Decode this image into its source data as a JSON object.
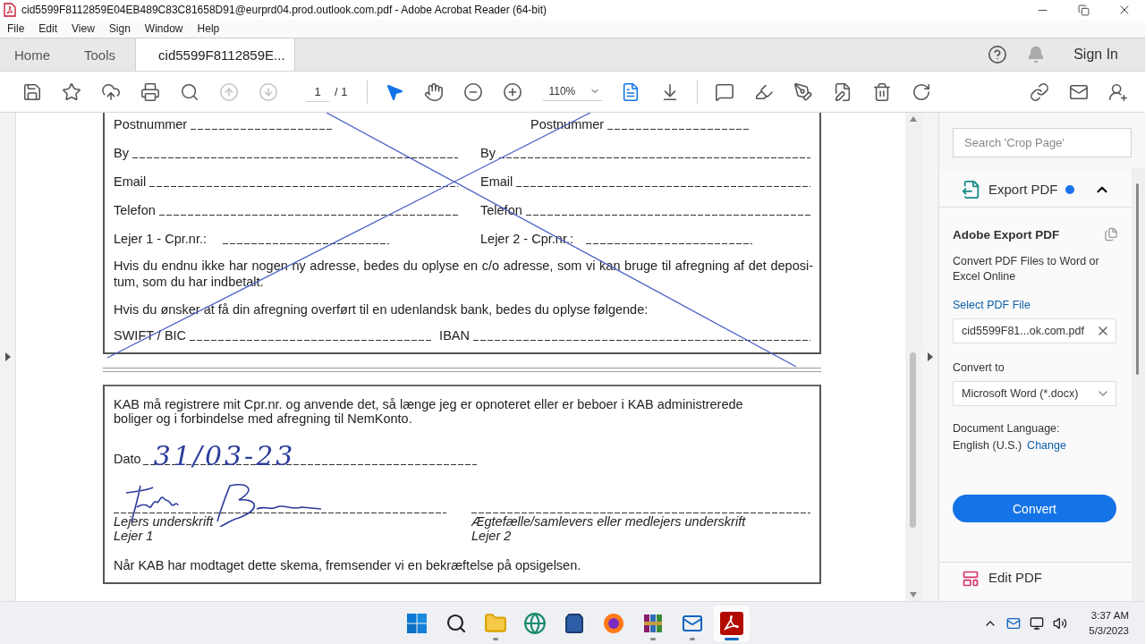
{
  "window": {
    "title": "cid5599F8112859E04EB489C83C81658D91@eurprd04.prod.outlook.com.pdf - Adobe Acrobat Reader (64-bit)"
  },
  "menu": [
    "File",
    "Edit",
    "View",
    "Sign",
    "Window",
    "Help"
  ],
  "tabs": [
    {
      "label": "Home",
      "selected": false
    },
    {
      "label": "Tools",
      "selected": false
    },
    {
      "label": "cid5599F8112859E...",
      "selected": true
    }
  ],
  "header": {
    "sign_in": "Sign In",
    "notifications_disabled": true
  },
  "toolbar": {
    "page": "1",
    "page_total": "/ 1",
    "zoom": "110%",
    "tools": [
      {
        "kind": "save",
        "selected": false,
        "disabled": false
      },
      {
        "kind": "bookmark",
        "selected": false,
        "disabled": false
      },
      {
        "kind": "upload",
        "selected": false,
        "disabled": false
      },
      {
        "kind": "print",
        "selected": false,
        "disabled": false
      },
      {
        "kind": "find",
        "selected": false,
        "disabled": false
      },
      {
        "kind": "prev",
        "selected": false,
        "disabled": true
      },
      {
        "kind": "next",
        "selected": false,
        "disabled": true
      },
      {
        "kind": "page"
      },
      {
        "kind": "separator"
      },
      {
        "kind": "select",
        "selected": true,
        "disabled": false
      },
      {
        "kind": "hand",
        "selected": false,
        "disabled": false
      },
      {
        "kind": "zoom_out",
        "selected": false,
        "disabled": false
      },
      {
        "kind": "zoom_in",
        "selected": false,
        "disabled": false
      },
      {
        "kind": "zoom"
      },
      {
        "kind": "fit",
        "selected": true,
        "disabled": false
      },
      {
        "kind": "scroll",
        "selected": false,
        "disabled": false
      },
      {
        "kind": "separator"
      },
      {
        "kind": "comment",
        "selected": false,
        "disabled": false
      },
      {
        "kind": "highlight",
        "selected": false,
        "disabled": false
      },
      {
        "kind": "sign",
        "selected": false,
        "disabled": false
      },
      {
        "kind": "organize",
        "selected": false,
        "disabled": false
      },
      {
        "kind": "delete",
        "selected": false,
        "disabled": false
      },
      {
        "kind": "rotate",
        "selected": false,
        "disabled": false
      },
      {
        "kind": "spacer"
      },
      {
        "kind": "share_link",
        "selected": false,
        "disabled": false
      },
      {
        "kind": "email",
        "selected": false,
        "disabled": false
      },
      {
        "kind": "add_user",
        "selected": false,
        "disabled": false
      }
    ]
  },
  "document": {
    "crossed_out": true,
    "address_rows": [
      {
        "kind": "postal",
        "left": "Postnummer",
        "right": "Postnummer"
      },
      {
        "kind": "full",
        "left": "By",
        "right": "By"
      },
      {
        "kind": "full",
        "left": "Email",
        "right": "Email"
      },
      {
        "kind": "full",
        "left": "Telefon",
        "right": "Telefon"
      },
      {
        "kind": "cpr",
        "left": "Lejer 1 - Cpr.nr.:",
        "right": "Lejer 2 - Cpr.nr.:"
      }
    ],
    "notes": [
      "Hvis du endnu ikke har nogen ny adresse, bedes du oplyse en c/o adresse, som vi kan bruge til afregning af det deposi-tum, som du har indbetalt.",
      "Hvis du ønsker at få din afregning overført til en udenlandsk bank, bedes du oplyse følgende:"
    ],
    "bank": [
      "SWIFT / BIC",
      "IBAN"
    ],
    "consent": "KAB må registrere mit Cpr.nr. og anvende det, så længe jeg er opnoteret eller er beboer i KAB administrerede boliger og i forbindelse med afregning til NemKonto.",
    "date": {
      "label": "Dato",
      "value": "31/03-23"
    },
    "signatures": [
      {
        "caption": "Lejers underskrift",
        "tenant": "Lejer 1",
        "signed": true
      },
      {
        "caption": "Ægtefælle/samlevers eller medlejers underskrift",
        "tenant": "Lejer 2",
        "signed": false
      }
    ],
    "footer": "Når KAB har modtaget dette skema, fremsender vi en bekræftelse på opsigelsen."
  },
  "side_panel": {
    "search": {
      "placeholder": "Search 'Crop Page'"
    },
    "tool": {
      "title": "Export PDF",
      "expanded": true
    },
    "heading": "Adobe Export PDF",
    "description": "Convert PDF Files to Word or Excel Online",
    "select_link": "Select PDF File",
    "file": {
      "value": "cid5599F81...ok.com.pdf"
    },
    "convert_label": "Convert to",
    "format": {
      "value": "Microsoft Word (*.docx)"
    },
    "language_label": "Document Language:",
    "language": "English (U.S.)",
    "change_link": "Change",
    "convert_button": "Convert",
    "next_tool": "Edit PDF"
  },
  "taskbar": {
    "apps": [
      {
        "kind": "start",
        "running": false,
        "selected": false
      },
      {
        "kind": "search",
        "running": false,
        "selected": false
      },
      {
        "kind": "explorer",
        "running": true,
        "selected": false
      },
      {
        "kind": "edge",
        "running": false,
        "selected": false
      },
      {
        "kind": "store",
        "running": false,
        "selected": false
      },
      {
        "kind": "firefox",
        "running": false,
        "selected": false
      },
      {
        "kind": "winrar",
        "running": true,
        "selected": false
      },
      {
        "kind": "outlook",
        "running": true,
        "selected": false
      },
      {
        "kind": "acrobat",
        "running": true,
        "selected": true
      }
    ],
    "time": "3:37 AM",
    "date": "5/3/2023"
  }
}
